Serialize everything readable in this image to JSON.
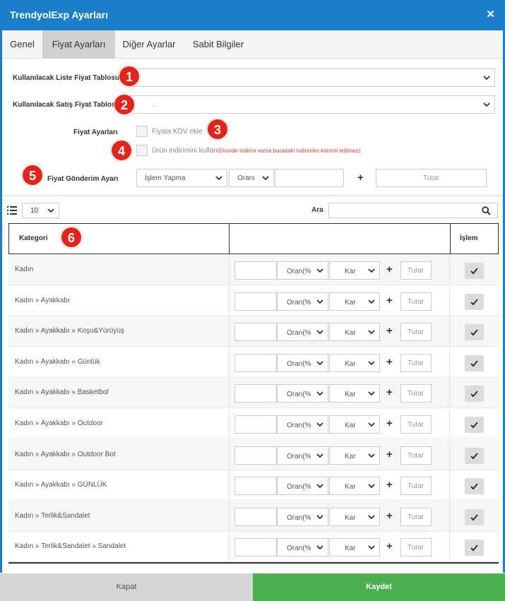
{
  "window": {
    "title": "TrendyolExp Ayarları",
    "close_symbol": "✕"
  },
  "tabs": [
    {
      "label": "Genel",
      "active": false
    },
    {
      "label": "Fiyat Ayarları",
      "active": true
    },
    {
      "label": "Diğer Ayarlar",
      "active": false
    },
    {
      "label": "Sabit Bilgiler",
      "active": false
    }
  ],
  "form": {
    "list_price_label": "Kullanılacak Liste Fiyat Tablosu",
    "list_price_value": "",
    "sale_price_label": "Kullanılacak Satış Fiyat Tablosu",
    "sale_price_value": ".",
    "price_settings_label": "Fiyat Ayarları",
    "kdv_checkbox_label": "Fiyata KDV ekle",
    "discount_checkbox_label": "Ürün indirimini kullan",
    "discount_warning": "(Üründe indirim varsa buradaki indirimler kontrol edilmez)",
    "send_setting_label": "Fiyat Gönderim Ayarı",
    "send_action_value": "İşlem Yapma",
    "send_rate_value": "Oranı",
    "plus_symbol": "+",
    "amount_placeholder": "Tutar"
  },
  "badges": [
    "1",
    "2",
    "3",
    "4",
    "5",
    "6"
  ],
  "table_controls": {
    "page_size": "10",
    "search_label": "Ara",
    "search_value": ""
  },
  "table": {
    "headers": {
      "category": "Kategori",
      "middle": "",
      "action": "İşlem"
    },
    "rows": [
      {
        "category": "Kadın",
        "rate_value": "Oran(%",
        "type_value": "Kar",
        "amount_placeholder": "Tutar"
      },
      {
        "category": "Kadın » Ayakkabı",
        "rate_value": "Oran(%",
        "type_value": "Kar",
        "amount_placeholder": "Tutar"
      },
      {
        "category": "Kadın » Ayakkabı » Koşu&Yürüyüş",
        "rate_value": "Oran(%",
        "type_value": "Kar",
        "amount_placeholder": "Tutar"
      },
      {
        "category": "Kadın » Ayakkabı » Günlük",
        "rate_value": "Oran(%",
        "type_value": "Kar",
        "amount_placeholder": "Tutar"
      },
      {
        "category": "Kadın » Ayakkabı » Basketbol",
        "rate_value": "Oran(%",
        "type_value": "Kar",
        "amount_placeholder": "Tutar"
      },
      {
        "category": "Kadın » Ayakkabı » Outdoor",
        "rate_value": "Oran(%",
        "type_value": "Kar",
        "amount_placeholder": "Tutar"
      },
      {
        "category": "Kadın » Ayakkabı » Outdoor Bot",
        "rate_value": "Oran(%",
        "type_value": "Kar",
        "amount_placeholder": "Tutar"
      },
      {
        "category": "Kadın » Ayakkabı » GÜNLÜK",
        "rate_value": "Oran(%",
        "type_value": "Kar",
        "amount_placeholder": "Tutar"
      },
      {
        "category": "Kadın » Terlik&Sandalet",
        "rate_value": "Oran(%",
        "type_value": "Kar",
        "amount_placeholder": "Tutar"
      },
      {
        "category": "Kadın » Terlik&Sandalet » Sandalet",
        "rate_value": "Oran(%",
        "type_value": "Kar",
        "amount_placeholder": "Tutar"
      }
    ]
  },
  "footer": {
    "close_label": "Kapat",
    "save_label": "Kaydet"
  },
  "colors": {
    "title_bar": "#1a7fcb",
    "save_button": "#4caf50",
    "close_button": "#d6d6d6",
    "badge": "#e3241b",
    "warning_text": "#e53935"
  },
  "icons": {
    "title_close": "close-icon",
    "dropdown": "chevron-down-icon",
    "list_view": "list-icon",
    "search": "search-icon",
    "row_action": "check-icon"
  }
}
